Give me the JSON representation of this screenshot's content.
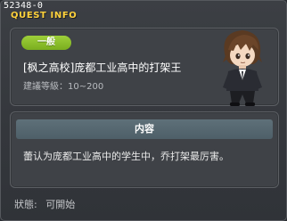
{
  "window": {
    "id": "52348-0",
    "title": "QUEST INFO"
  },
  "quest": {
    "category_badge": "一般",
    "name": "[枫之高校]庞都工业高中的打架王",
    "level_text": "建議等級：10~200"
  },
  "content": {
    "header": "内容",
    "description": "蕾认为庞都工业高中的学生中，乔打架最厉害。"
  },
  "status": {
    "label": "狀態:",
    "value": "可開始"
  },
  "colors": {
    "title": "#ffd23c",
    "badge": "#8cc12c",
    "section_header": "#566872"
  },
  "portrait": {
    "icon": "character-portrait"
  }
}
